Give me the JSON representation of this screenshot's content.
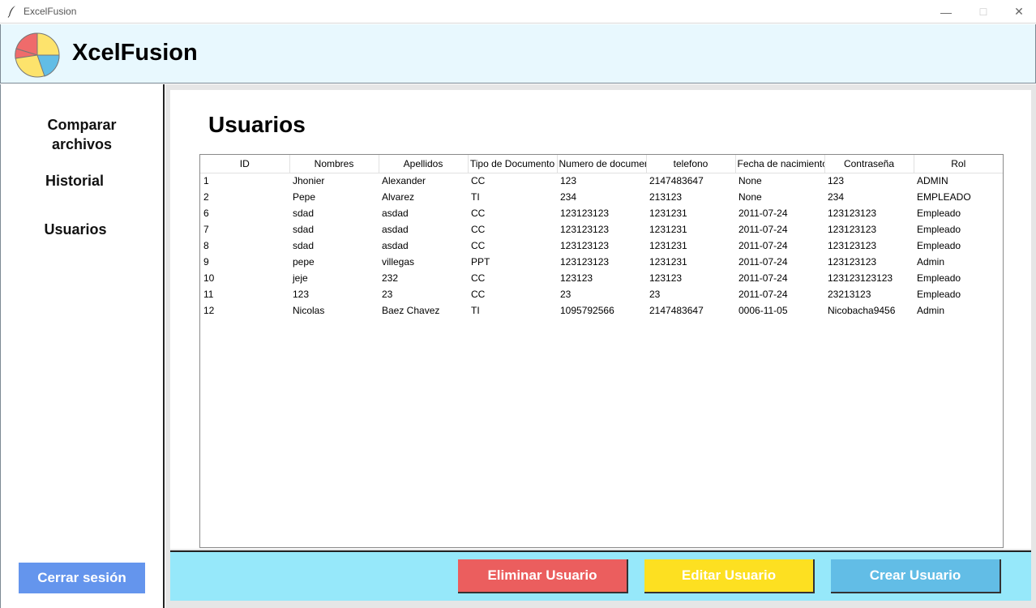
{
  "window": {
    "title": "ExcelFusion",
    "minimize_glyph": "—",
    "maximize_glyph": "☐",
    "close_glyph": "✕"
  },
  "header": {
    "app_name": "XcelFusion"
  },
  "sidebar": {
    "items": [
      {
        "label": "Comparar archivos"
      },
      {
        "label": "Historial"
      },
      {
        "label": "Usuarios"
      }
    ],
    "logout_label": "Cerrar sesión"
  },
  "main": {
    "title": "Usuarios",
    "table": {
      "columns": [
        "ID",
        "Nombres",
        "Apellidos",
        "Tipo de Documento",
        "Numero de documento",
        "telefono",
        "Fecha de nacimiento",
        "Contraseña",
        "Rol"
      ],
      "rows": [
        [
          "1",
          "Jhonier",
          "Alexander",
          "CC",
          "123",
          "2147483647",
          "None",
          "123",
          "ADMIN"
        ],
        [
          "2",
          "Pepe",
          "Alvarez",
          "TI",
          "234",
          "213123",
          "None",
          "234",
          "EMPLEADO"
        ],
        [
          "6",
          "sdad",
          "asdad",
          "CC",
          "123123123",
          "1231231",
          "2011-07-24",
          "123123123",
          "Empleado"
        ],
        [
          "7",
          "sdad",
          "asdad",
          "CC",
          "123123123",
          "1231231",
          "2011-07-24",
          "123123123",
          "Empleado"
        ],
        [
          "8",
          "sdad",
          "asdad",
          "CC",
          "123123123",
          "1231231",
          "2011-07-24",
          "123123123",
          "Empleado"
        ],
        [
          "9",
          "pepe",
          "villegas",
          "PPT",
          "123123123",
          "1231231",
          "2011-07-24",
          "123123123",
          "Admin"
        ],
        [
          "10",
          "jeje",
          "232",
          "CC",
          "123123",
          "123123",
          "2011-07-24",
          "123123123123",
          "Empleado"
        ],
        [
          "11",
          "123",
          "23",
          "CC",
          "23",
          "23",
          "2011-07-24",
          "23213123",
          "Empleado"
        ],
        [
          "12",
          "Nicolas",
          "Baez Chavez",
          "TI",
          "1095792566",
          "2147483647",
          "0006-11-05",
          "Nicobacha9456",
          "Admin"
        ]
      ]
    }
  },
  "actions": {
    "delete_label": "Eliminar Usuario",
    "edit_label": "Editar Usuario",
    "create_label": "Crear Usuario"
  },
  "colors": {
    "header_bg": "#e8f8fe",
    "action_bar_bg": "#96e8fa",
    "logout_bg": "#6495ed",
    "delete_bg": "#eb5e5e",
    "edit_bg": "#fde021",
    "create_bg": "#62bde6"
  }
}
